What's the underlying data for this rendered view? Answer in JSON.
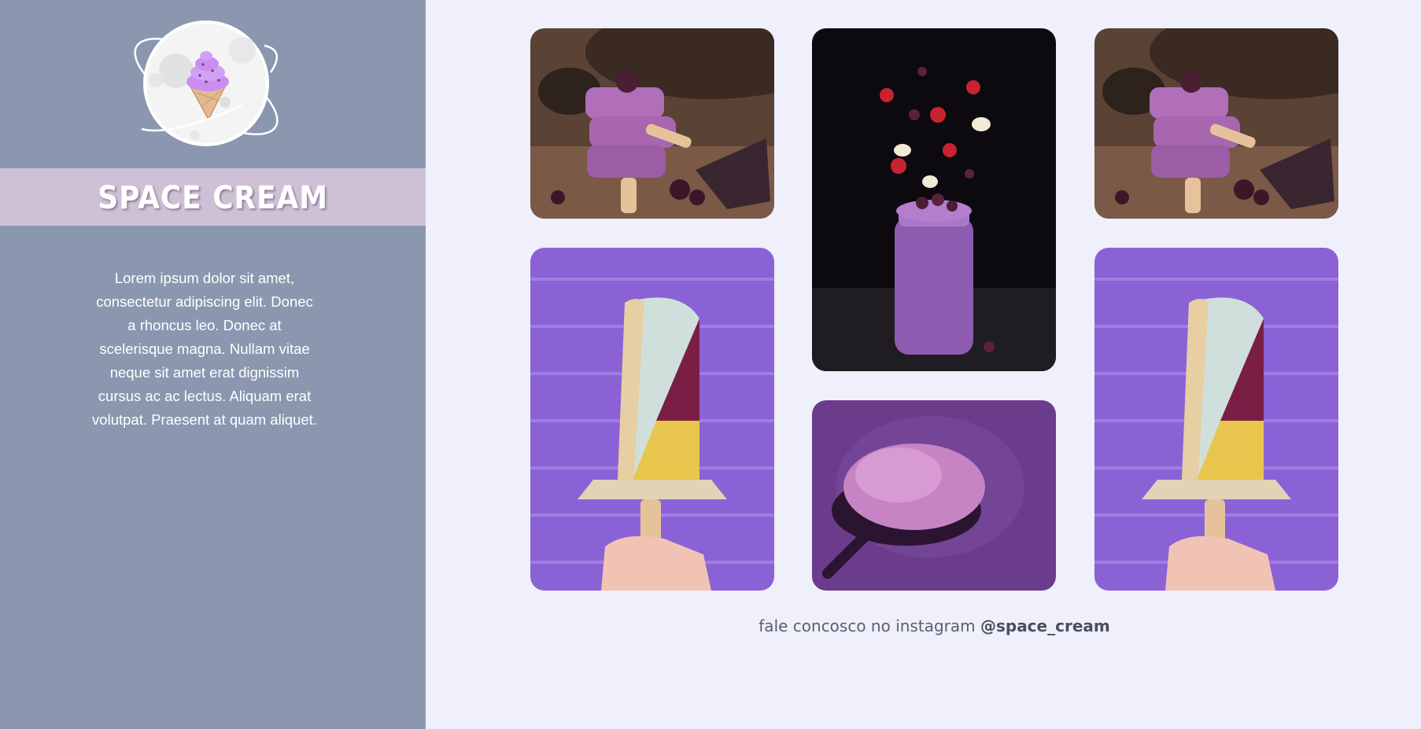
{
  "sidebar": {
    "logo_icon": "ice-cream-planet-logo",
    "title": "SPACE CREAM",
    "description": "Lorem ipsum dolor sit amet, consectetur adipiscing elit. Donec a rhoncus leo. Donec at scelerisque magna. Nullam vitae neque sit amet erat dignissim cursus ac ac lectus. Aliquam erat volutpat. Praesent at quam aliquet."
  },
  "gallery": {
    "photos": [
      {
        "subject": "stacked-berry-popsicles"
      },
      {
        "subject": "berry-smoothie-jar-with-flying-fruit"
      },
      {
        "subject": "stacked-berry-popsicles"
      },
      {
        "subject": "hand-holding-layered-popsicle"
      },
      {
        "subject": "spoon-of-purple-ice-cream"
      },
      {
        "subject": "hand-holding-layered-popsicle"
      }
    ]
  },
  "footer": {
    "instagram_text": "fale concosco no instagram",
    "instagram_handle": "@space_cream"
  },
  "colors": {
    "sidebar_bg": "#8a97af",
    "title_band": "#cec1d6",
    "page_bg": "#eff0fb",
    "accent_purple": "#9b6fd0"
  }
}
